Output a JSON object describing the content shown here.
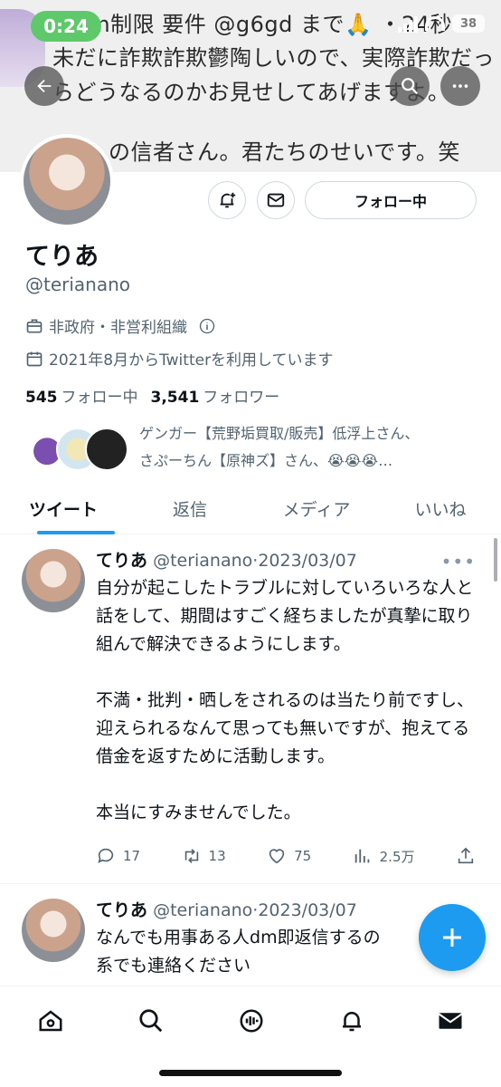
{
  "status_bar": {
    "time": "0:24",
    "battery": "38"
  },
  "banner": {
    "lines": [
      "・dm制限 要件 @g6gd まで🙏 ・24秒",
      "未だに詐欺詐欺鬱陶しいので、実際詐欺だっ",
      "らどうなるのかお見せしてあげますよ。",
      "の信者さん。君たちのせいです。笑"
    ]
  },
  "profile": {
    "display_name": "てりあ",
    "handle": "@terianano",
    "category": "非政府・非営利組織",
    "joined": "2021年8月からTwitterを利用しています",
    "following_count": "545",
    "following_label": "フォロー中",
    "followers_count": "3,541",
    "followers_label": "フォロワー",
    "follow_button": "フォロー中",
    "followed_by_line1": "ゲンガー【荒野垢買取/販売】低浮上さん、",
    "followed_by_line2": "さぷーちん【原神ズ】さん、😭😭😭…"
  },
  "tabs": [
    "ツイート",
    "返信",
    "メディア",
    "いいね"
  ],
  "tweets": [
    {
      "name": "てりあ",
      "meta": "@terianano·2023/03/07",
      "paragraphs": [
        "自分が起こしたトラブルに対していろいろな人と話をして、期間はすごく経ちましたが真摯に取り組んで解決できるようにします。",
        "不満・批判・晒しをされるのは当たり前ですし、迎えられるなんて思っても無いですが、抱えてる借金を返すために活動します。",
        "本当にすみませんでした。"
      ],
      "replies": "17",
      "retweets": "13",
      "likes": "75",
      "views": "2.5万"
    },
    {
      "name": "てりあ",
      "meta": "@terianano·2023/03/07",
      "paragraphs": [
        "なんでも用事ある人dm即返信するの",
        "系でも連絡ください"
      ]
    }
  ],
  "icons": {
    "back": "arrow-left-icon",
    "search": "search-icon",
    "more": "more-icon",
    "notify": "bell-plus-icon",
    "message": "envelope-icon",
    "compose": "plus-icon"
  },
  "colors": {
    "accent": "#1d9bf0",
    "time_pill": "#5ec96b",
    "text_secondary": "#536471"
  }
}
